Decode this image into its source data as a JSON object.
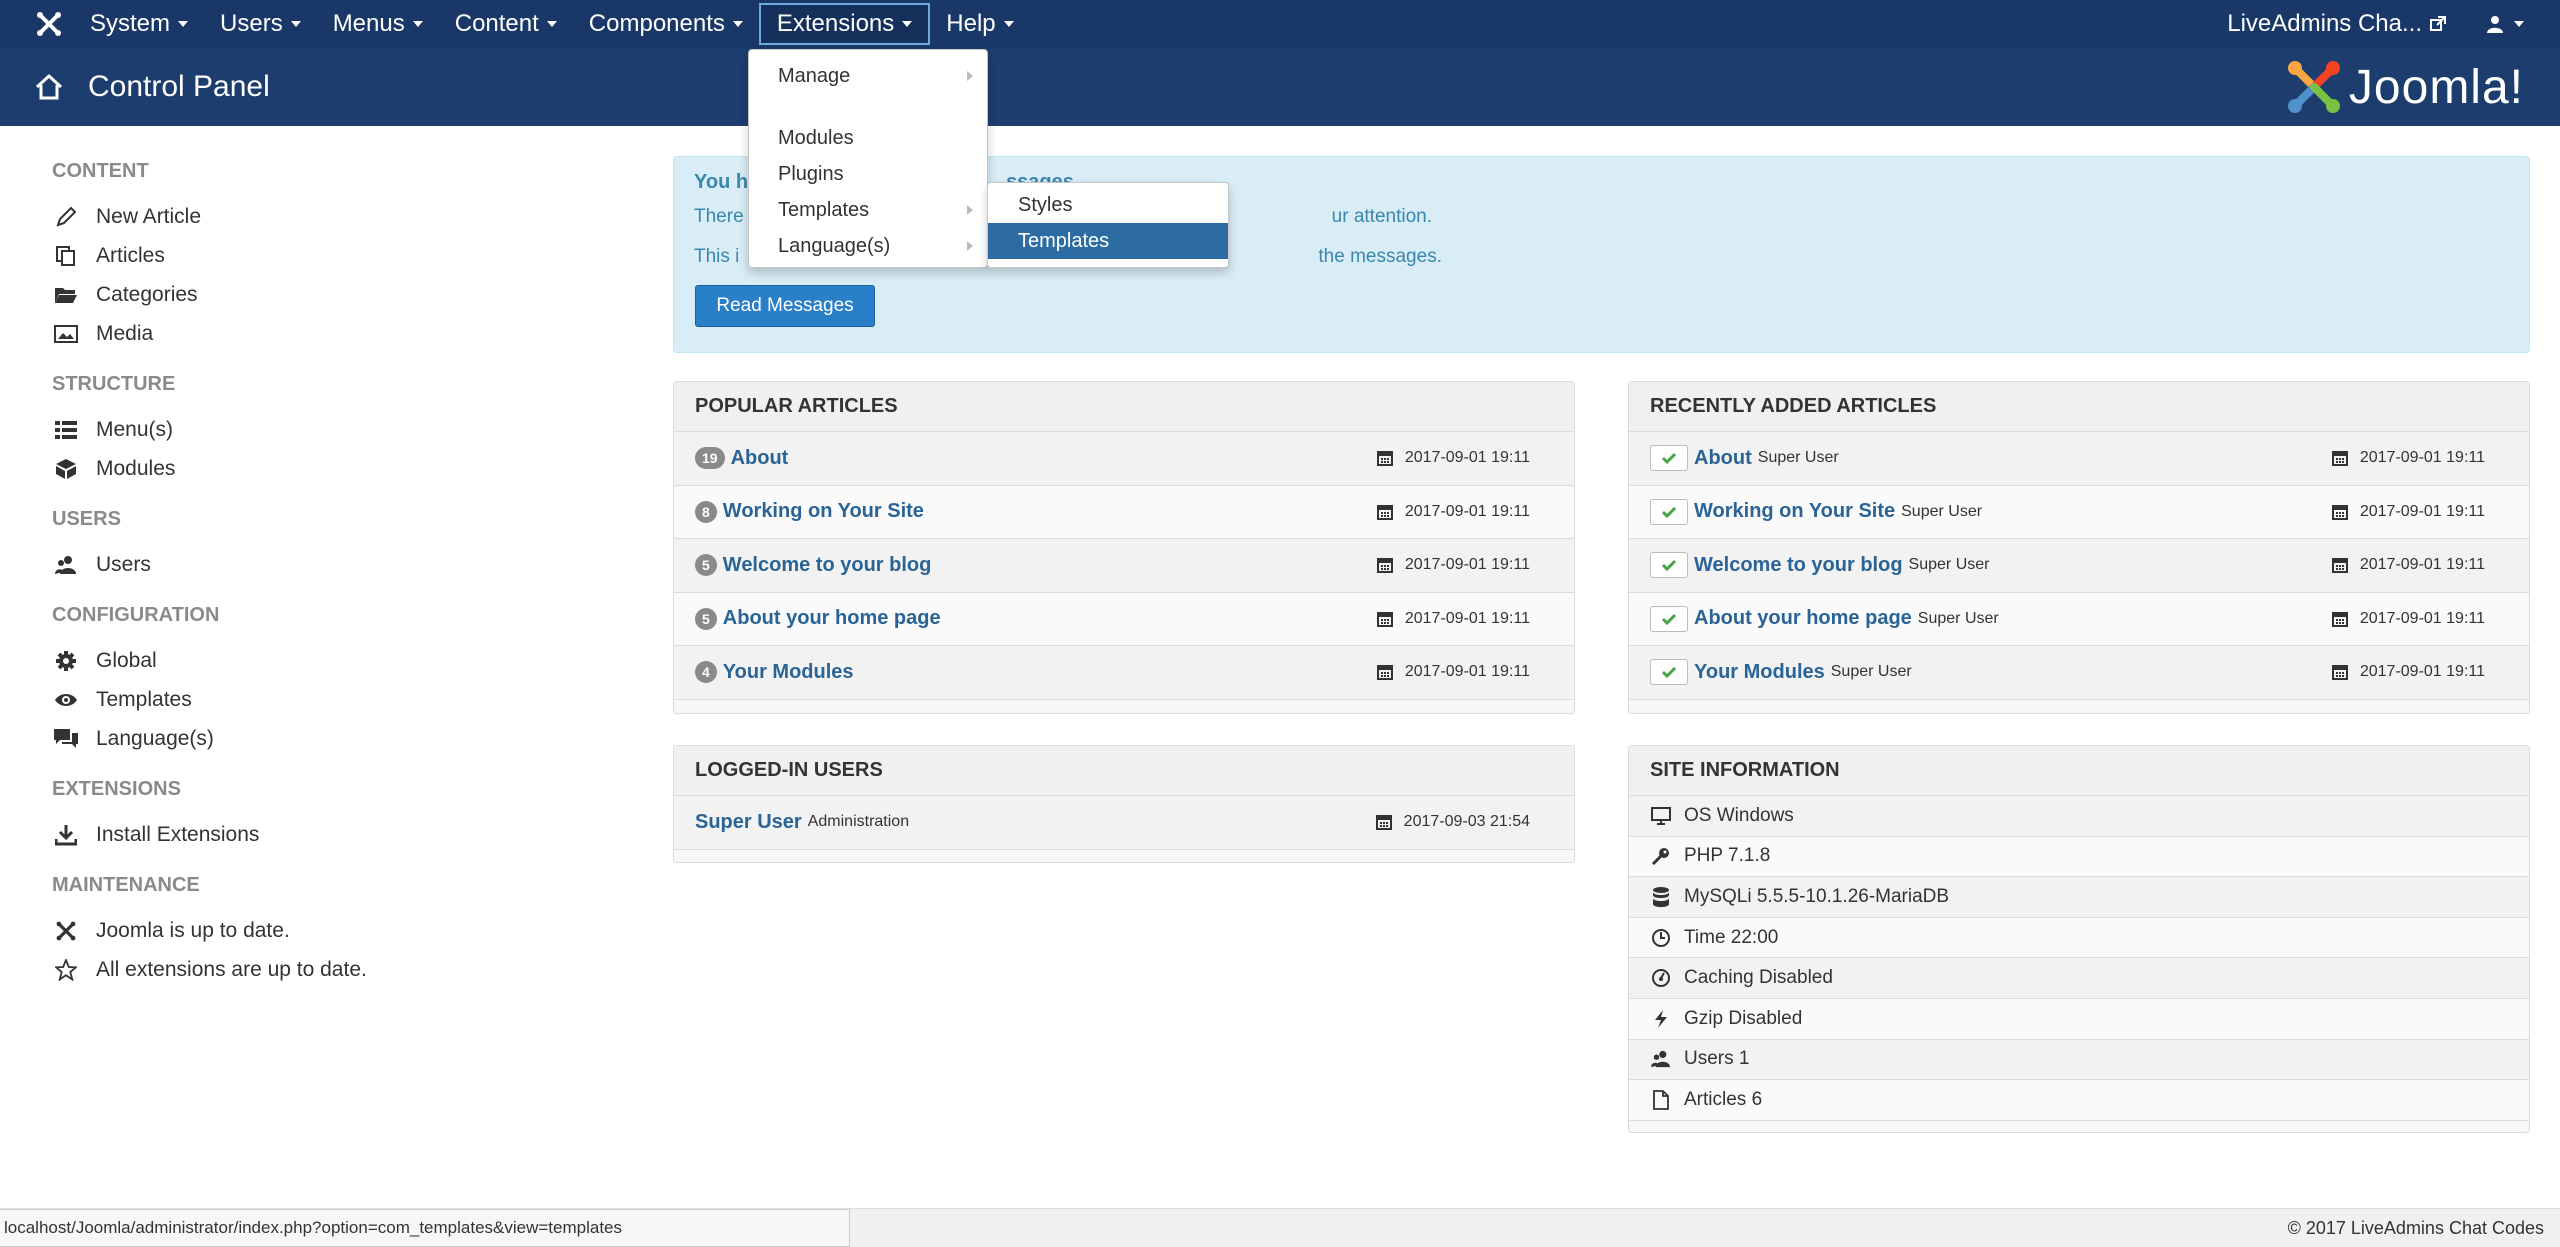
{
  "topnav": {
    "menus": [
      "System",
      "Users",
      "Menus",
      "Content",
      "Components",
      "Extensions",
      "Help"
    ],
    "active_menu": "Extensions",
    "site_link": "LiveAdmins Cha...",
    "icons": {
      "brand": "joomla-icon",
      "external": "external-link-icon",
      "user": "user-icon"
    }
  },
  "header": {
    "title": "Control Panel",
    "logo_text": "Joomla!"
  },
  "extensions_menu": {
    "items": [
      {
        "label": "Manage",
        "submenu": true
      },
      {
        "label": "Modules",
        "submenu": false
      },
      {
        "label": "Plugins",
        "submenu": false
      },
      {
        "label": "Templates",
        "submenu": true
      },
      {
        "label": "Language(s)",
        "submenu": true
      }
    ],
    "templates_submenu": [
      "Styles",
      "Templates"
    ],
    "highlighted": "Templates"
  },
  "sidebar": {
    "content_head": "CONTENT",
    "content": [
      "New Article",
      "Articles",
      "Categories",
      "Media"
    ],
    "structure_head": "STRUCTURE",
    "structure": [
      "Menu(s)",
      "Modules"
    ],
    "users_head": "USERS",
    "users": [
      "Users"
    ],
    "config_head": "CONFIGURATION",
    "config": [
      "Global",
      "Templates",
      "Language(s)"
    ],
    "extensions_head": "EXTENSIONS",
    "extensions": [
      "Install Extensions"
    ],
    "maintenance_head": "MAINTENANCE",
    "maintenance": [
      "Joomla is up to date.",
      "All extensions are up to date."
    ]
  },
  "message": {
    "title_start": "You h",
    "title_end": "ssages",
    "line1_start": "There",
    "line1_end": "ur attention.",
    "line2_start": "This i",
    "line2_end": "the messages.",
    "button": "Read Messages"
  },
  "popular": {
    "title": "POPULAR ARTICLES",
    "rows": [
      {
        "hits": "19",
        "title": "About",
        "date": "2017-09-01 19:11"
      },
      {
        "hits": "8",
        "title": "Working on Your Site",
        "date": "2017-09-01 19:11"
      },
      {
        "hits": "5",
        "title": "Welcome to your blog",
        "date": "2017-09-01 19:11"
      },
      {
        "hits": "5",
        "title": "About your home page",
        "date": "2017-09-01 19:11"
      },
      {
        "hits": "4",
        "title": "Your Modules",
        "date": "2017-09-01 19:11"
      }
    ]
  },
  "recent": {
    "title": "RECENTLY ADDED ARTICLES",
    "rows": [
      {
        "title": "About",
        "author": "Super User",
        "date": "2017-09-01 19:11"
      },
      {
        "title": "Working on Your Site",
        "author": "Super User",
        "date": "2017-09-01 19:11"
      },
      {
        "title": "Welcome to your blog",
        "author": "Super User",
        "date": "2017-09-01 19:11"
      },
      {
        "title": "About your home page",
        "author": "Super User",
        "date": "2017-09-01 19:11"
      },
      {
        "title": "Your Modules",
        "author": "Super User",
        "date": "2017-09-01 19:11"
      }
    ]
  },
  "logged": {
    "title": "LOGGED-IN USERS",
    "rows": [
      {
        "name": "Super User",
        "location": "Administration",
        "date": "2017-09-03 21:54"
      }
    ]
  },
  "siteinfo": {
    "title": "SITE INFORMATION",
    "rows": [
      {
        "label": "OS Windows",
        "icon": "monitor-icon"
      },
      {
        "label": "PHP 7.1.8",
        "icon": "key-icon"
      },
      {
        "label": "MySQLi 5.5.5-10.1.26-MariaDB",
        "icon": "database-icon"
      },
      {
        "label": "Time 22:00",
        "icon": "clock-icon"
      },
      {
        "label": "Caching Disabled",
        "icon": "dashboard-icon"
      },
      {
        "label": "Gzip Disabled",
        "icon": "lightning-icon"
      },
      {
        "label": "Users 1",
        "icon": "users-icon"
      },
      {
        "label": "Articles 6",
        "icon": "file-icon"
      }
    ]
  },
  "statusbar": {
    "url": "localhost/Joomla/administrator/index.php?option=com_templates&view=templates",
    "copyright": "© 2017 LiveAdmins Chat Codes"
  },
  "colors": {
    "nav": "#1a3867",
    "header": "#1c3d6e",
    "link": "#2a6496",
    "alert_bg": "#d9edf7",
    "button": "#2a7fc9",
    "menu_highlight": "#2d6ca2"
  }
}
